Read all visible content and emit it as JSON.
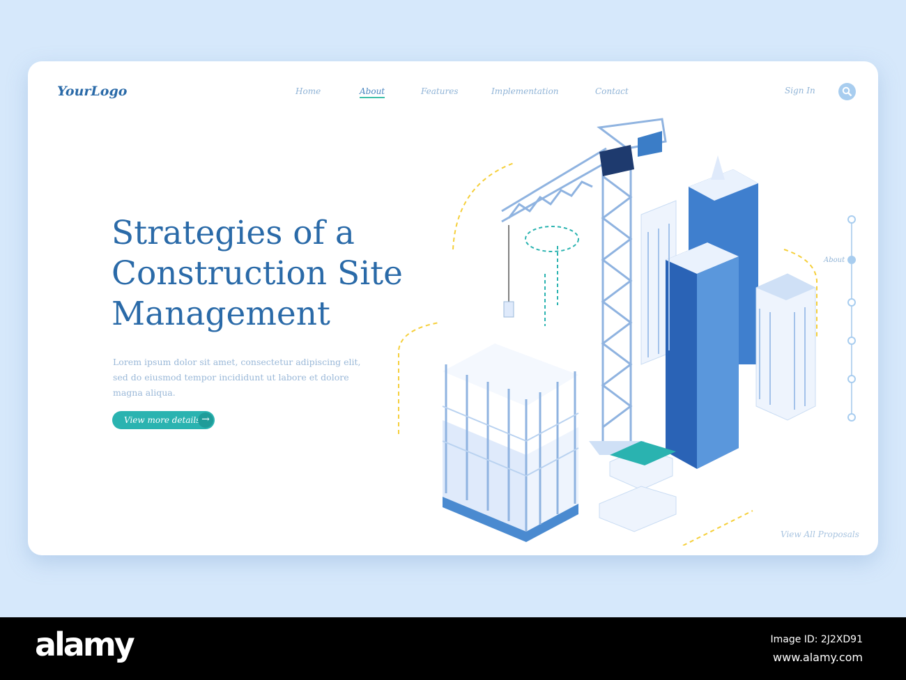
{
  "header": {
    "logo": "YourLogo",
    "nav": [
      "Home",
      "About",
      "Features",
      "Implementation",
      "Contact"
    ],
    "active": "About",
    "sign_in": "Sign In"
  },
  "hero": {
    "title_lines": [
      "Strategies of a",
      "Construction Site",
      "Management"
    ],
    "body": "Lorem ipsum dolor sit amet, consectetur adipiscing elit, sed do eiusmod tempor incididunt ut labore et dolore magna aliqua.",
    "button": "View more details"
  },
  "timeline": {
    "label": "About",
    "active_index": 1,
    "count": 6
  },
  "view_all": "View All Proposals",
  "footer": {
    "brand": "alamy",
    "image_id": "Image ID: 2J2XD91",
    "url": "www.alamy.com"
  },
  "colors": {
    "background": "#d6e8fb",
    "accent": "#2ab3b0",
    "primary": "#2a6aa8"
  }
}
